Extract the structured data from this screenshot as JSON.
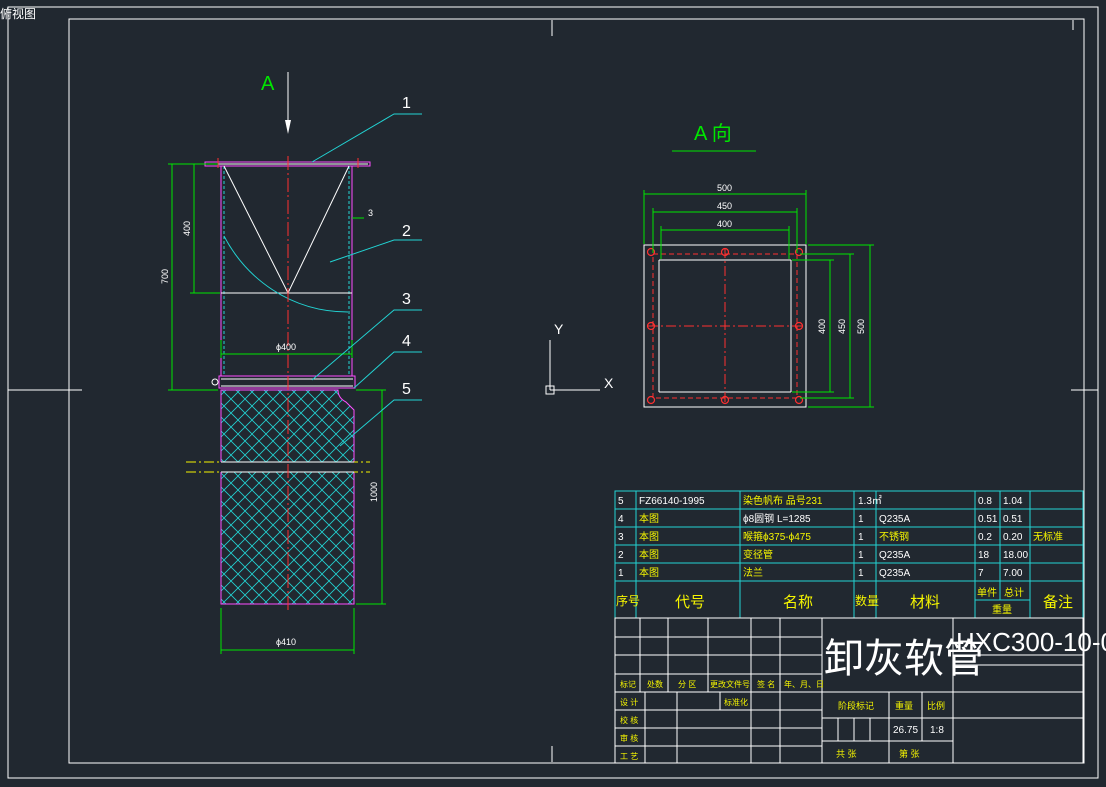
{
  "view_tab": "俯视图",
  "view_a": {
    "arrow_letter": "A",
    "title": "A 向"
  },
  "axis": {
    "y": "Y",
    "x": "X"
  },
  "callouts": [
    "1",
    "2",
    "3",
    "4",
    "5"
  ],
  "front_dims": {
    "total_height": "700",
    "upper_height": "400",
    "wall": "3",
    "inner_dia": "ϕ400",
    "lower_height": "1000",
    "outer_dia": "ϕ410"
  },
  "top_view_dims": {
    "w500": "500",
    "w450": "450",
    "w400": "400",
    "h400": "400",
    "h450": "450",
    "h500": "500"
  },
  "bom": {
    "rows": [
      {
        "no": "5",
        "code": "FZ66140-1995",
        "name": "染色帆布 品号231",
        "qty": "1.3㎡",
        "material": "",
        "unit": "0.8",
        "total": "1.04",
        "note": ""
      },
      {
        "no": "4",
        "code": "本图",
        "name": "ϕ8圆钢 L=1285",
        "qty": "1",
        "material": "Q235A",
        "unit": "0.51",
        "total": "0.51",
        "note": ""
      },
      {
        "no": "3",
        "code": "本图",
        "name": "喉箍ϕ375-ϕ475",
        "qty": "1",
        "material": "不锈钢",
        "unit": "0.2",
        "total": "0.20",
        "note": "无标准"
      },
      {
        "no": "2",
        "code": "本图",
        "name": "变径管",
        "qty": "1",
        "material": "Q235A",
        "unit": "18",
        "total": "18.00",
        "note": ""
      },
      {
        "no": "1",
        "code": "本图",
        "name": "法兰",
        "qty": "1",
        "material": "Q235A",
        "unit": "7",
        "total": "7.00",
        "note": ""
      }
    ],
    "headers": {
      "no": "序号",
      "code": "代号",
      "name": "名称",
      "qty": "数量",
      "material": "材料",
      "unit": "单件",
      "total": "总计",
      "weight": "重量",
      "note": "备注"
    }
  },
  "title_block": {
    "title": "卸灰软管",
    "drawing_no": "HXC300-10-0",
    "rev_labels": [
      "标记",
      "处数",
      "分 区",
      "更改文件号",
      "签 名",
      "年、月、日"
    ],
    "role_labels": [
      "设 计",
      "校 核",
      "审 核",
      "工 艺"
    ],
    "std_label": "标准化",
    "stage_label": "阶段标记",
    "weight_label": "重量",
    "scale_label": "比例",
    "weight": "26.75",
    "scale": "1:8",
    "sheets_total": "共 张",
    "sheet_no": "第 张"
  }
}
